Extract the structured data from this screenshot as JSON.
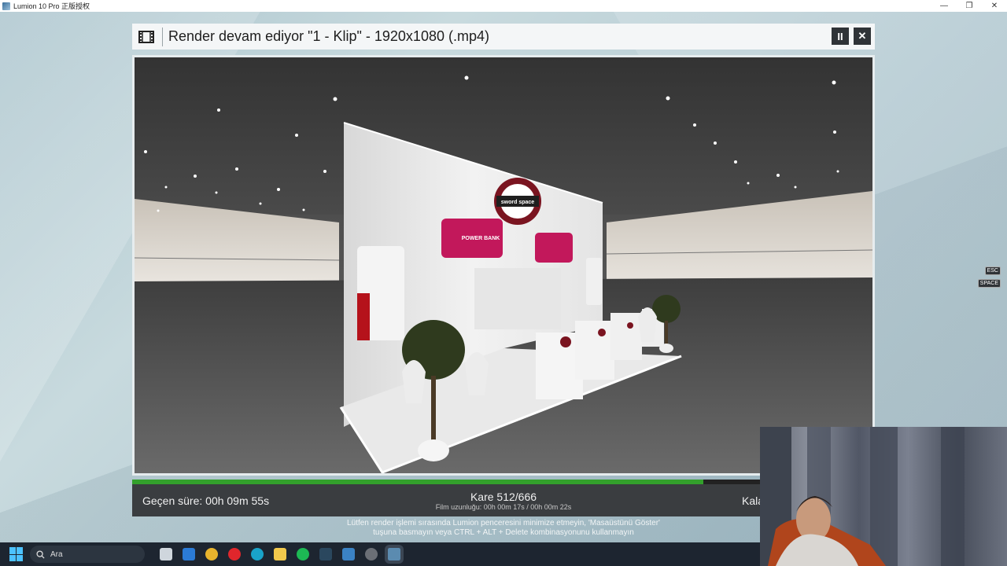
{
  "window": {
    "title": "Lumion 10 Pro 正版授权",
    "controls": [
      "—",
      "❐",
      "✕"
    ]
  },
  "dialog": {
    "title": "Render devam ediyor \"1 - Klip\" - 1920x1080 (.mp4)",
    "pause_label": "II",
    "close_label": "✕"
  },
  "progress": {
    "fraction": 0.7688
  },
  "status": {
    "elapsed": "Geçen süre: 00h 09m 55s",
    "frame": "Kare 512/666",
    "film_length": "Film uzunluğu: 00h 00m 17s / 00h 00m 22s",
    "remaining": "Kala"
  },
  "warning": {
    "line1": "Lütfen render işlemi sırasında Lumion penceresini minimize etmeyin, 'Masaüstünü Göster'",
    "line2": "tuşuna basmayın veya CTRL + ALT + Delete kombinasyonunu kullanmayın"
  },
  "hints": {
    "esc": "ESC",
    "space": "SPACE"
  },
  "scene": {
    "sign_text": "sword space",
    "panel_text": "POWER BANK"
  },
  "taskbar": {
    "search_placeholder": "Ara",
    "apps": [
      {
        "name": "task-view-icon",
        "color": "#cfd6dd"
      },
      {
        "name": "mail-icon",
        "color": "#2b7bd6"
      },
      {
        "name": "chrome-icon",
        "color": "#e8b42d"
      },
      {
        "name": "opera-icon",
        "color": "#e0262c"
      },
      {
        "name": "edge-icon",
        "color": "#19a3c9"
      },
      {
        "name": "file-explorer-icon",
        "color": "#f2c94c"
      },
      {
        "name": "spotify-icon",
        "color": "#1db954"
      },
      {
        "name": "steam-icon",
        "color": "#2a475e"
      },
      {
        "name": "photos-icon",
        "color": "#3b82c4"
      },
      {
        "name": "obs-icon",
        "color": "#6b6f76"
      },
      {
        "name": "lumion-icon",
        "color": "#5b8bb0"
      }
    ]
  }
}
